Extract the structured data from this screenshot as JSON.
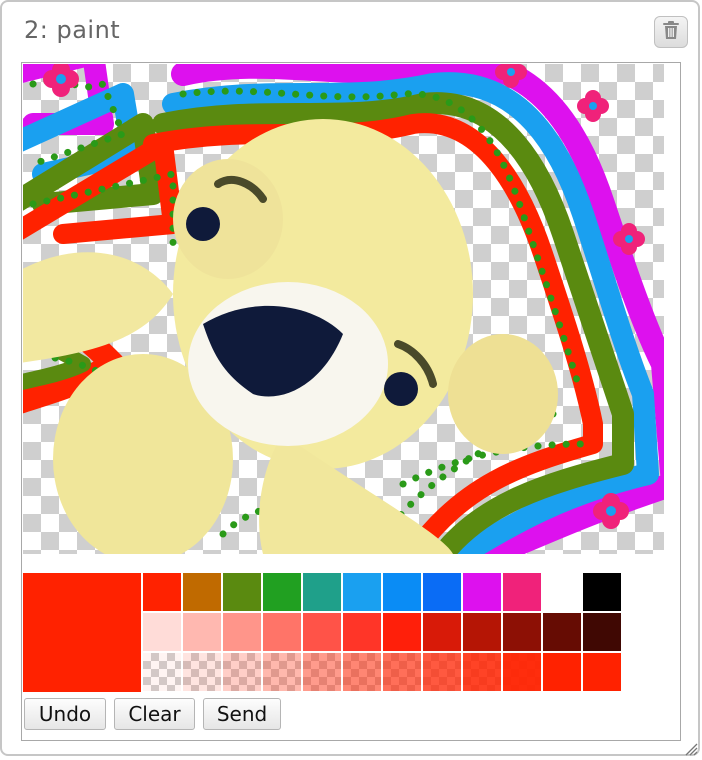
{
  "panel": {
    "title": "2: paint"
  },
  "icons": {
    "delete": "trash-icon",
    "resize": "resize-grip-icon"
  },
  "palette": {
    "current_color": "#ff2200",
    "swatches": [
      [
        "#ff2200",
        "#c06a00",
        "#5a8a10",
        "#21a021",
        "#1fa08a",
        "#1aa0f0",
        "#0a8cf5",
        "#0a6cf5",
        "#dd11ee",
        "#f0227a",
        "#ffffff",
        "#000000"
      ],
      [
        "#ffdcd8",
        "#ffb8b0",
        "#ff958a",
        "#ff7468",
        "#ff5348",
        "#ff3528",
        "#ff1f0a",
        "#d81a08",
        "#b51505",
        "#8d1005",
        "#660c03",
        "#400803"
      ],
      [
        "#ff2200",
        "#ff2200",
        "#ff2200",
        "#ff2200",
        "#ff2200",
        "#ff2200",
        "#ff2200",
        "#ff2200",
        "#ff2200",
        "#ff2200",
        "#ff2200",
        "#ff2200"
      ]
    ],
    "alpha_row": [
      0.05,
      0.12,
      0.22,
      0.32,
      0.45,
      0.55,
      0.65,
      0.75,
      0.85,
      0.95,
      1,
      1
    ]
  },
  "buttons": {
    "undo": "Undo",
    "clear": "Clear",
    "send": "Send"
  }
}
